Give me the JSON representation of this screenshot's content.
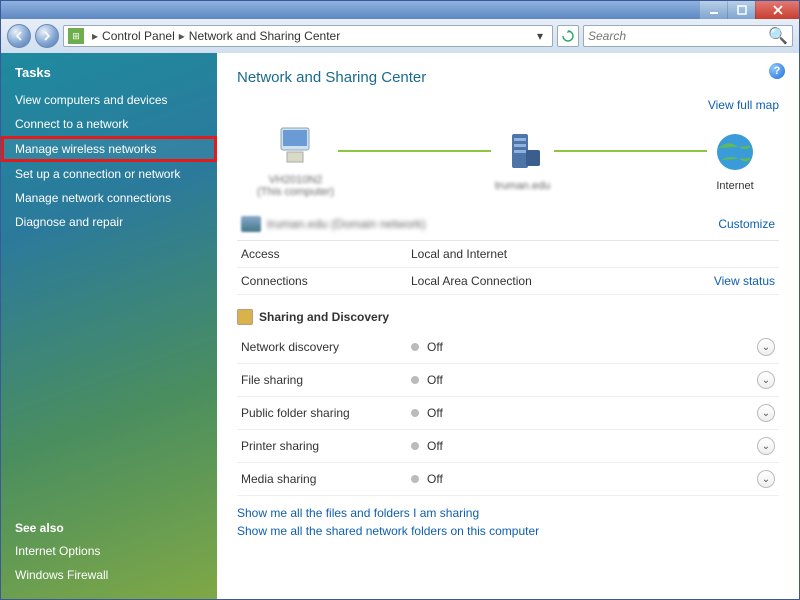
{
  "titlebar": {
    "min": "_",
    "max": "▢",
    "close": "✕"
  },
  "breadcrumb": {
    "part1": "Control Panel",
    "part2": "Network and Sharing Center",
    "sep": "▸",
    "drop": "▾"
  },
  "search": {
    "placeholder": "Search"
  },
  "sidebar": {
    "tasks_title": "Tasks",
    "items": [
      {
        "label": "View computers and devices"
      },
      {
        "label": "Connect to a network"
      },
      {
        "label": "Manage wireless networks"
      },
      {
        "label": "Set up a connection or network"
      },
      {
        "label": "Manage network connections"
      },
      {
        "label": "Diagnose and repair"
      }
    ],
    "see_also_title": "See also",
    "see_also": [
      {
        "label": "Internet Options"
      },
      {
        "label": "Windows Firewall"
      }
    ]
  },
  "main": {
    "heading": "Network and Sharing Center",
    "full_map_link": "View full map",
    "map": {
      "node1": {
        "label": "(This computer)",
        "name": "VH2010N2"
      },
      "node2": {
        "label": "truman.edu"
      },
      "node3": {
        "label": "Internet"
      }
    },
    "network": {
      "name": "truman.edu (Domain network)",
      "customize": "Customize"
    },
    "rows": [
      {
        "k": "Access",
        "v": "Local and Internet",
        "act": ""
      },
      {
        "k": "Connections",
        "v": "Local Area Connection",
        "act": "View status"
      }
    ],
    "section": "Sharing and Discovery",
    "sharing": [
      {
        "k": "Network discovery",
        "v": "Off"
      },
      {
        "k": "File sharing",
        "v": "Off"
      },
      {
        "k": "Public folder sharing",
        "v": "Off"
      },
      {
        "k": "Printer sharing",
        "v": "Off"
      },
      {
        "k": "Media sharing",
        "v": "Off"
      }
    ],
    "links": {
      "l1": "Show me all the files and folders I am sharing",
      "l2": "Show me all the shared network folders on this computer"
    }
  }
}
